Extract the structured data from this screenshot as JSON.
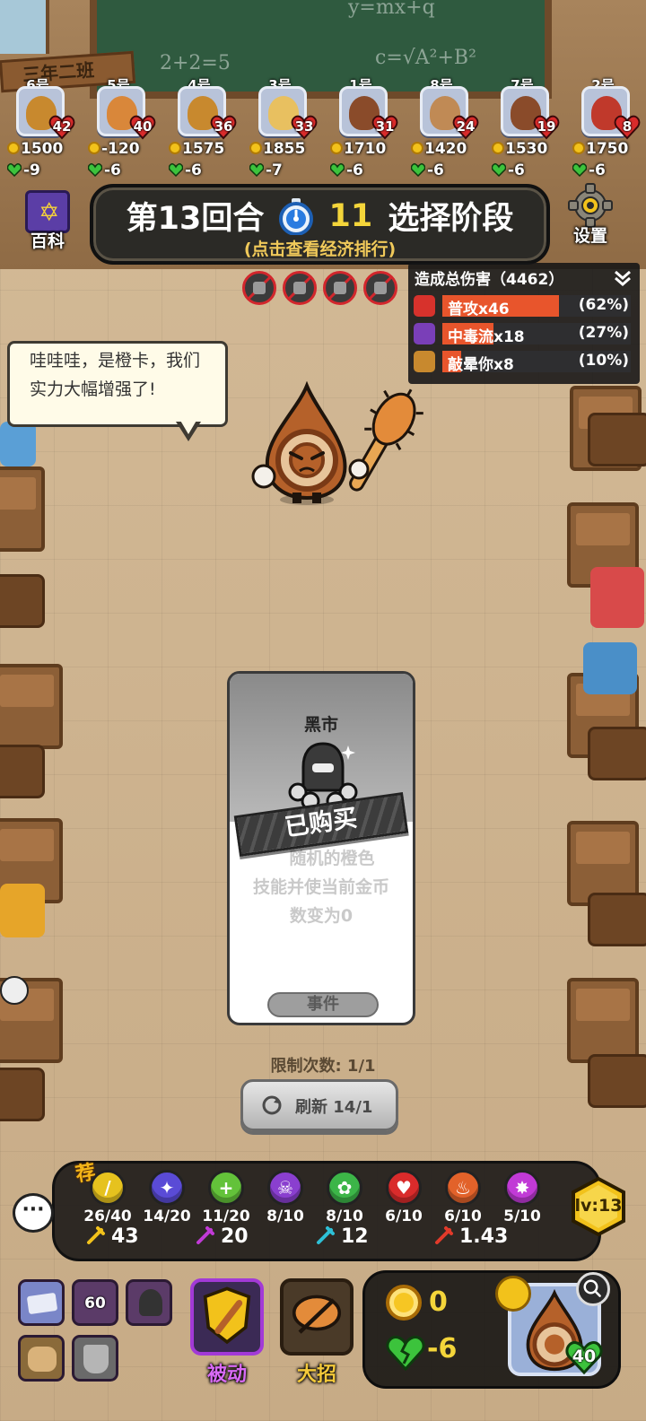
{
  "classroom": {
    "sign": "三年二班",
    "chalk_1": "y=mx+q",
    "chalk_2": "c=√A²+B²",
    "chalk_3": "2+2=5"
  },
  "players": [
    {
      "num": "6号",
      "hp": "42",
      "gold": "1500",
      "heart": "-9",
      "color": "#c8892e"
    },
    {
      "num": "5号",
      "hp": "40",
      "gold": "-120",
      "heart": "-6",
      "color": "#d9873a"
    },
    {
      "num": "4号",
      "hp": "36",
      "gold": "1575",
      "heart": "-6",
      "color": "#c8892e"
    },
    {
      "num": "3号",
      "hp": "33",
      "gold": "1855",
      "heart": "-7",
      "color": "#e8c060"
    },
    {
      "num": "1号",
      "hp": "31",
      "gold": "1710",
      "heart": "-6",
      "color": "#8a4b2a"
    },
    {
      "num": "8号",
      "hp": "24",
      "gold": "1420",
      "heart": "-6",
      "color": "#c08a55"
    },
    {
      "num": "7号",
      "hp": "19",
      "gold": "1530",
      "heart": "-6",
      "color": "#8a4b2a"
    },
    {
      "num": "2号",
      "hp": "8",
      "gold": "1750",
      "heart": "-6",
      "color": "#c0392b"
    }
  ],
  "header": {
    "wiki_label": "百科",
    "round": "第13回合",
    "timer": "11",
    "phase": "选择阶段",
    "subtitle": "(点击查看经济排行)",
    "settings_label": "设置"
  },
  "damage": {
    "title": "造成总伤害（4462）",
    "rows": [
      {
        "name": "普攻x46",
        "pct": "(62%)",
        "fraction": 0.62,
        "icon_color": "#d7322c",
        "icon": "sword-icon"
      },
      {
        "name": "中毒流x18",
        "pct": "(27%)",
        "fraction": 0.27,
        "icon_color": "#7a3fb8",
        "icon": "skull-icon"
      },
      {
        "name": "敲晕你x8",
        "pct": "(10%)",
        "fraction": 0.1,
        "icon_color": "#c8892e",
        "icon": "fist-icon"
      }
    ]
  },
  "bubble": {
    "line1": "哇哇哇，是橙卡，我们",
    "line2": "实力大幅增强了!"
  },
  "card": {
    "title": "黑市",
    "status": "已购买",
    "desc_line1": "随机的橙色",
    "desc_line2": "技能并使当前金币",
    "desc_line3": "数变为0",
    "type": "事件"
  },
  "limit": "限制次数: 1/1",
  "refresh": "刷新 14/1",
  "synergy": {
    "recommend": "荐",
    "orbs": [
      {
        "count": "26/40",
        "color": "#e6c21e",
        "glyph": "/"
      },
      {
        "count": "14/20",
        "color": "#5a4bd6",
        "glyph": "✦"
      },
      {
        "count": "11/20",
        "color": "#63c23a",
        "glyph": "+"
      },
      {
        "count": "8/10",
        "color": "#8a3fcf",
        "glyph": "☠"
      },
      {
        "count": "8/10",
        "color": "#3cb548",
        "glyph": "✿"
      },
      {
        "count": "6/10",
        "color": "#d92b2b",
        "glyph": "♥"
      },
      {
        "count": "6/10",
        "color": "#e2622a",
        "glyph": "♨"
      },
      {
        "count": "5/10",
        "color": "#c13ad6",
        "glyph": "✸"
      }
    ],
    "stats": [
      {
        "value": "43",
        "icon": "sword-icon",
        "color": "#f2c21b"
      },
      {
        "value": "20",
        "icon": "burst-icon",
        "color": "#c13ad6"
      },
      {
        "value": "12",
        "icon": "wing-icon",
        "color": "#2ec0d6"
      },
      {
        "value": "1.43",
        "icon": "crit-icon",
        "color": "#e23a2a"
      }
    ],
    "level": "lv:13"
  },
  "chat": "···",
  "bottom": {
    "slot_gold": "60",
    "passive_label": "被动",
    "ultimate_label": "大招",
    "coins": "0",
    "hearts": "-6",
    "hero_hp": "40"
  }
}
